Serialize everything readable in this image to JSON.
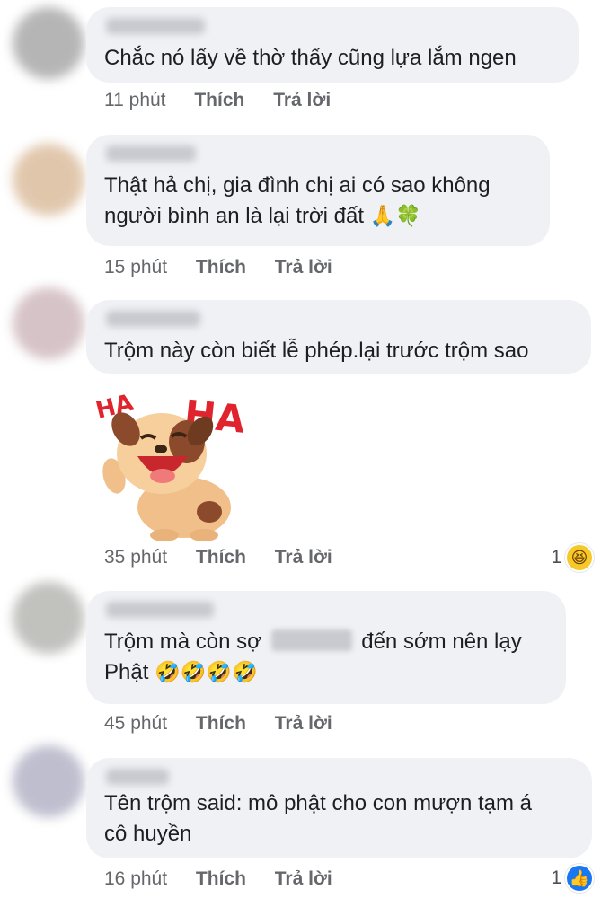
{
  "comments": [
    {
      "text": "Chắc nó lấy về thờ thấy cũng lựa lắm ngen",
      "time": "11 phút",
      "like": "Thích",
      "reply": "Trả lời"
    },
    {
      "line1": "Thật hả chị, gia đình chị ai có sao không",
      "line2": "người bình an là lại trời đất",
      "emoji": "🙏🍀",
      "time": "15 phút",
      "like": "Thích",
      "reply": "Trả lời"
    },
    {
      "text": "Trộm này còn biết lễ phép.lại trước trộm sao",
      "sticker_text": "HA",
      "time": "35 phút",
      "like": "Thích",
      "reply": "Trả lời",
      "reaction_count": "1",
      "reaction_icon": "haha-icon"
    },
    {
      "line1a": "Trộm mà còn sợ",
      "line1b": "đến sớm nên lạy",
      "line2": "Phật",
      "emoji": "🤣🤣🤣🤣",
      "time": "45 phút",
      "like": "Thích",
      "reply": "Trả lời"
    },
    {
      "line1": "Tên trộm said: mô phật cho con mượn tạm á",
      "line2": "cô huyền",
      "time": "16 phút",
      "like": "Thích",
      "reply": "Trả lời",
      "reaction_count": "1",
      "reaction_icon": "like-icon"
    }
  ],
  "colors": {
    "bubble": "#eff1f4",
    "meta_text": "#65676b",
    "like_blue": "#1877f2",
    "haha_yellow": "#f7c928"
  }
}
